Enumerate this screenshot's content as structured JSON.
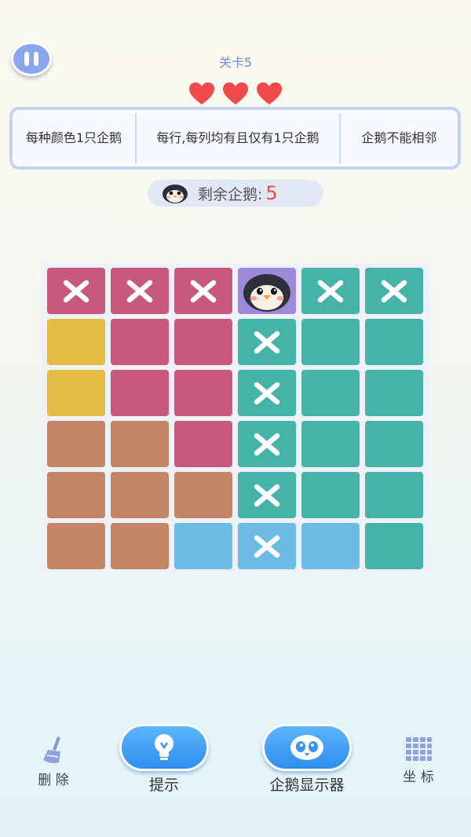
{
  "header": {
    "level_label": "关卡5",
    "lives": 3
  },
  "rules": [
    "每种颜色1只企鹅",
    "每行,每列均有且仅有1只企鹅",
    "企鹅不能相邻"
  ],
  "remaining": {
    "label": "剩余企鹅:",
    "count": "5"
  },
  "board": {
    "rows": 6,
    "cols": 6,
    "colors": {
      "pink": "#c7597f",
      "yellow": "#e3bb47",
      "brown": "#c38564",
      "teal": "#46b3a9",
      "blue": "#6bbbe6",
      "purple": "#9c8ad8"
    },
    "cells": [
      [
        {
          "color": "pink",
          "mark": "x"
        },
        {
          "color": "pink",
          "mark": "x"
        },
        {
          "color": "pink",
          "mark": "x"
        },
        {
          "color": "purple",
          "mark": "penguin"
        },
        {
          "color": "teal",
          "mark": "x"
        },
        {
          "color": "teal",
          "mark": "x"
        }
      ],
      [
        {
          "color": "yellow",
          "mark": ""
        },
        {
          "color": "pink",
          "mark": ""
        },
        {
          "color": "pink",
          "mark": ""
        },
        {
          "color": "teal",
          "mark": "x"
        },
        {
          "color": "teal",
          "mark": ""
        },
        {
          "color": "teal",
          "mark": ""
        }
      ],
      [
        {
          "color": "yellow",
          "mark": ""
        },
        {
          "color": "pink",
          "mark": ""
        },
        {
          "color": "pink",
          "mark": ""
        },
        {
          "color": "teal",
          "mark": "x"
        },
        {
          "color": "teal",
          "mark": ""
        },
        {
          "color": "teal",
          "mark": ""
        }
      ],
      [
        {
          "color": "brown",
          "mark": ""
        },
        {
          "color": "brown",
          "mark": ""
        },
        {
          "color": "pink",
          "mark": ""
        },
        {
          "color": "teal",
          "mark": "x"
        },
        {
          "color": "teal",
          "mark": ""
        },
        {
          "color": "teal",
          "mark": ""
        }
      ],
      [
        {
          "color": "brown",
          "mark": ""
        },
        {
          "color": "brown",
          "mark": ""
        },
        {
          "color": "brown",
          "mark": ""
        },
        {
          "color": "teal",
          "mark": "x"
        },
        {
          "color": "teal",
          "mark": ""
        },
        {
          "color": "teal",
          "mark": ""
        }
      ],
      [
        {
          "color": "brown",
          "mark": ""
        },
        {
          "color": "brown",
          "mark": ""
        },
        {
          "color": "blue",
          "mark": ""
        },
        {
          "color": "blue",
          "mark": "x"
        },
        {
          "color": "blue",
          "mark": ""
        },
        {
          "color": "teal",
          "mark": ""
        }
      ]
    ]
  },
  "toolbar": {
    "delete_label": "删 除",
    "hint_label": "提示",
    "penguin_display_label": "企鹅显示器",
    "coords_label": "坐 标"
  }
}
